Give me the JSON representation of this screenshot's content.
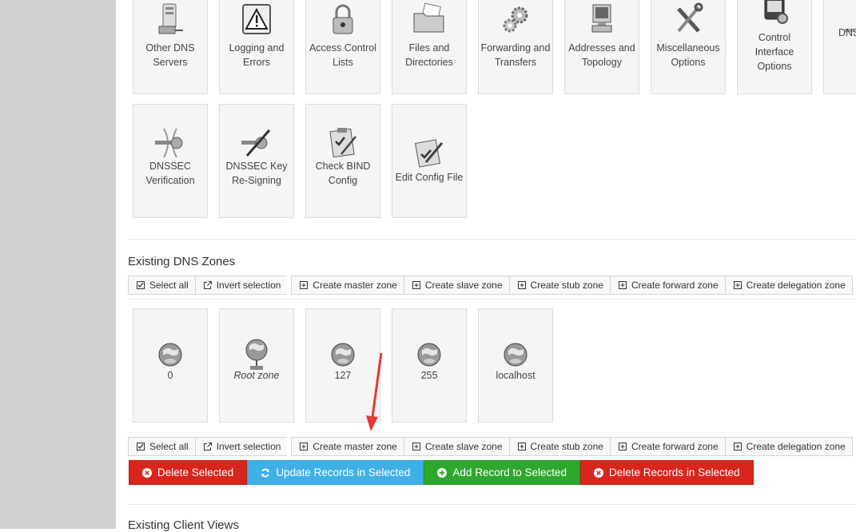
{
  "module_tiles": [
    {
      "label": "Other DNS Servers",
      "icon": "server-icon"
    },
    {
      "label": "Logging and Errors",
      "icon": "warning-icon"
    },
    {
      "label": "Access Control Lists",
      "icon": "lock-icon"
    },
    {
      "label": "Files and Directories",
      "icon": "folder-icon"
    },
    {
      "label": "Forwarding and Transfers",
      "icon": "gears-icon"
    },
    {
      "label": "Addresses and Topology",
      "icon": "computer-icon"
    },
    {
      "label": "Miscellaneous Options",
      "icon": "tools-icon"
    },
    {
      "label": "Control Interface Options",
      "icon": "control-panel-icon"
    },
    {
      "label": "DNS",
      "icon": "key-icon"
    },
    {
      "label": "DNSSEC Verification",
      "icon": "dnssec-key-icon"
    },
    {
      "label": "DNSSEC Key Re-Signing",
      "icon": "resign-key-icon"
    },
    {
      "label": "Check BIND Config",
      "icon": "checklist-icon"
    },
    {
      "label": "Edit Config File",
      "icon": "edit-icon"
    }
  ],
  "zones_section": {
    "title": "Existing DNS Zones"
  },
  "toolbar": {
    "select_all": "Select all",
    "invert_selection": "Invert selection",
    "create_master": "Create master zone",
    "create_slave": "Create slave zone",
    "create_stub": "Create stub zone",
    "create_forward": "Create forward zone",
    "create_delegation": "Create delegation zone"
  },
  "zones": [
    {
      "label": "0",
      "italic": false,
      "icon": "globe-icon"
    },
    {
      "label": "Root zone",
      "italic": true,
      "icon": "globe-network-icon"
    },
    {
      "label": "127",
      "italic": false,
      "icon": "globe-icon"
    },
    {
      "label": "255",
      "italic": false,
      "icon": "globe-icon"
    },
    {
      "label": "localhost",
      "italic": false,
      "icon": "globe-icon"
    }
  ],
  "actions": {
    "delete_selected": "Delete Selected",
    "update_records": "Update Records in Selected",
    "add_record": "Add Record to Selected",
    "delete_records": "Delete Records in Selected"
  },
  "views_section": {
    "title": "Existing Client Views"
  },
  "colors": {
    "red": "#d9261c",
    "blue": "#3fb0e6",
    "green": "#2da82d",
    "annotation_arrow": "#e53935"
  }
}
